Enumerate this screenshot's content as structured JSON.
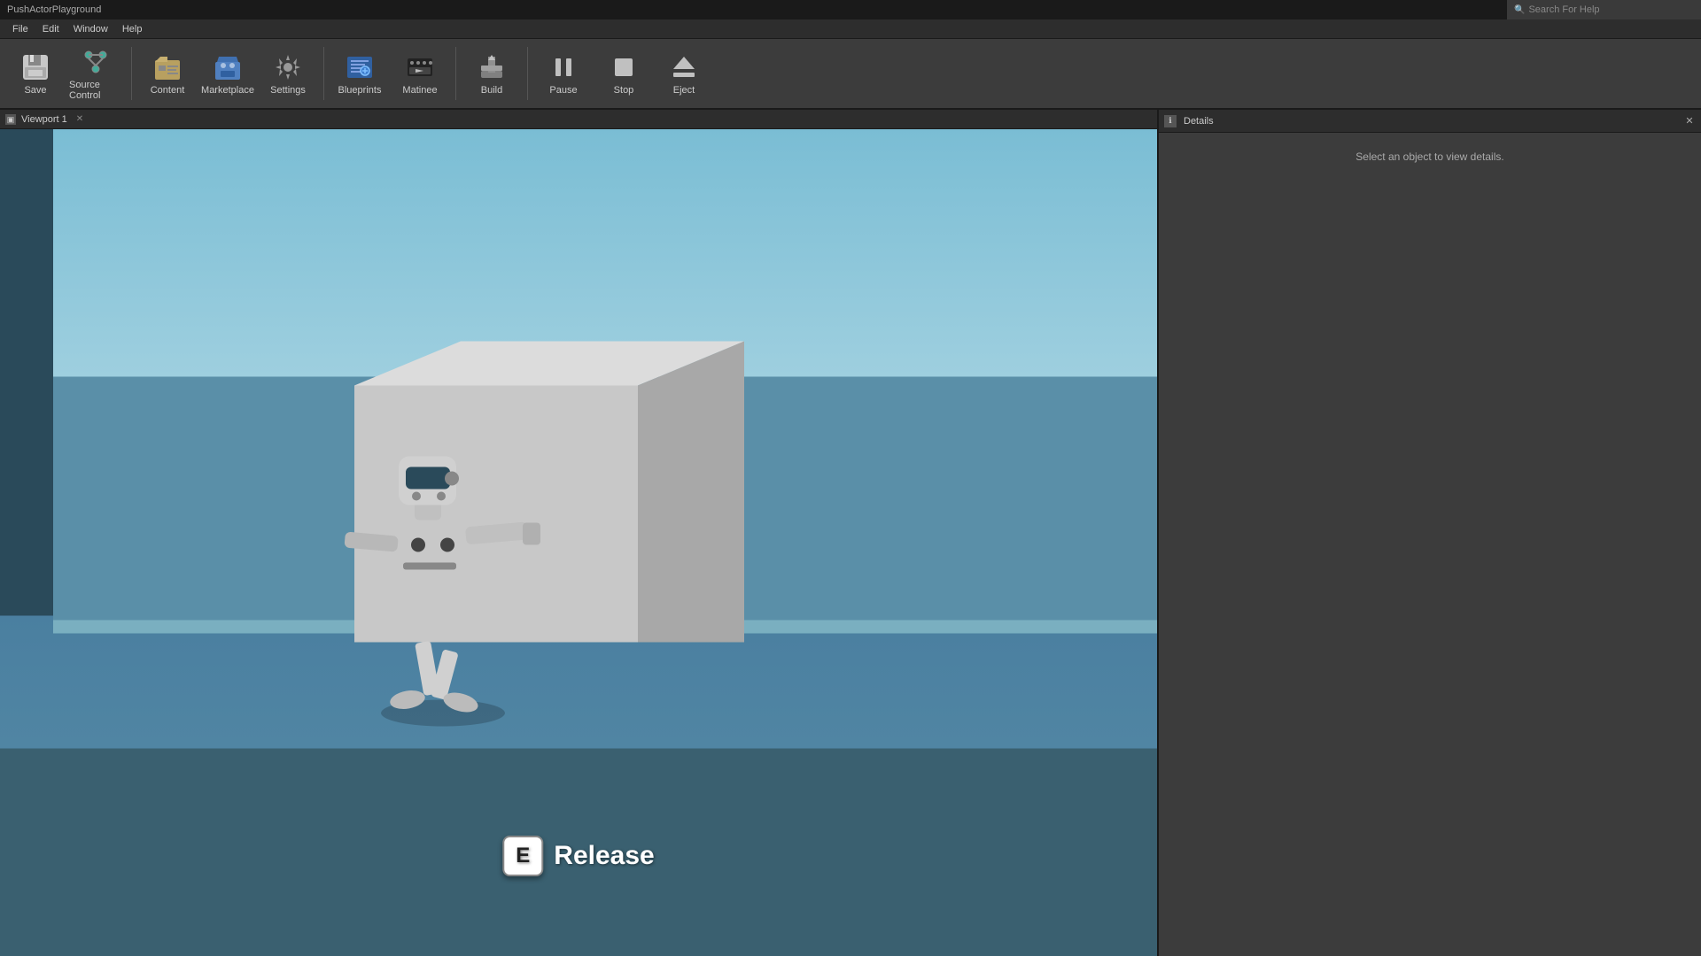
{
  "titlebar": {
    "app_name": "PushActorPlayground",
    "search_placeholder": "Search For Help"
  },
  "menubar": {
    "items": [
      "File",
      "Edit",
      "Window",
      "Help"
    ]
  },
  "toolbar": {
    "buttons": [
      {
        "id": "save",
        "label": "Save",
        "icon": "💾"
      },
      {
        "id": "source-control",
        "label": "Source Control",
        "icon": "⑂"
      },
      {
        "id": "content",
        "label": "Content",
        "icon": "📁"
      },
      {
        "id": "marketplace",
        "label": "Marketplace",
        "icon": "🛒"
      },
      {
        "id": "settings",
        "label": "Settings",
        "icon": "⚙"
      },
      {
        "id": "blueprints",
        "label": "Blueprints",
        "icon": "📋"
      },
      {
        "id": "matinee",
        "label": "Matinee",
        "icon": "🎬"
      },
      {
        "id": "build",
        "label": "Build",
        "icon": "🔨"
      },
      {
        "id": "pause",
        "label": "Pause",
        "icon": "⏸"
      },
      {
        "id": "stop",
        "label": "Stop",
        "icon": "⏹"
      },
      {
        "id": "eject",
        "label": "Eject",
        "icon": "⏏"
      }
    ]
  },
  "viewport": {
    "tab_label": "Viewport 1"
  },
  "release_badge": {
    "key": "E",
    "text": "Release"
  },
  "details_panel": {
    "tab_label": "Details",
    "empty_message": "Select an object to view details."
  }
}
